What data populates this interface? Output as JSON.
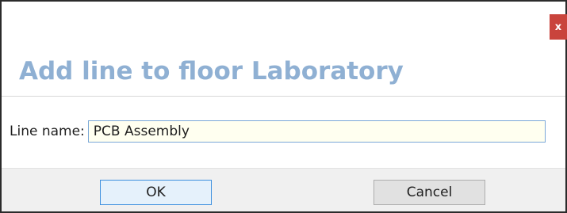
{
  "dialog": {
    "close_label": "x",
    "title": "Add line to floor Laboratory"
  },
  "form": {
    "line_name_label": "Line name:",
    "line_name_value": "PCB Assembly"
  },
  "buttons": {
    "ok_label": "OK",
    "cancel_label": "Cancel"
  },
  "colors": {
    "title": "#8fb0d3",
    "close_button": "#c9443c",
    "input_background": "#fffff0",
    "input_border": "#7aa7d8",
    "ok_border": "#3c8fde"
  }
}
